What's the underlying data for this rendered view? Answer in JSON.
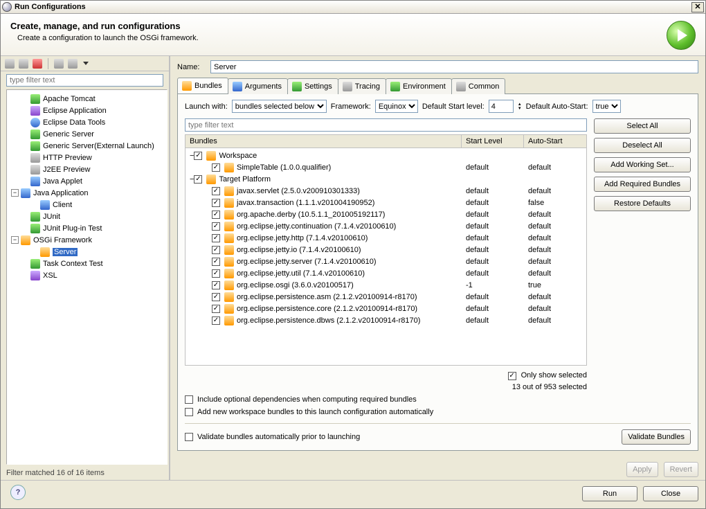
{
  "window": {
    "title": "Run Configurations"
  },
  "header": {
    "title": "Create, manage, and run configurations",
    "subtitle": "Create a configuration to launch the OSGi framework."
  },
  "leftpane": {
    "filter_placeholder": "type filter text",
    "items": [
      {
        "label": "Apache Tomcat",
        "icon": "ic-green",
        "indent": 1,
        "exp": ""
      },
      {
        "label": "Eclipse Application",
        "icon": "ic-purple",
        "indent": 1,
        "exp": ""
      },
      {
        "label": "Eclipse Data Tools",
        "icon": "ic-cyls",
        "indent": 1,
        "exp": ""
      },
      {
        "label": "Generic Server",
        "icon": "ic-green",
        "indent": 1,
        "exp": ""
      },
      {
        "label": "Generic Server(External Launch)",
        "icon": "ic-green",
        "indent": 1,
        "exp": ""
      },
      {
        "label": "HTTP Preview",
        "icon": "ic-grey",
        "indent": 1,
        "exp": ""
      },
      {
        "label": "J2EE Preview",
        "icon": "ic-grey",
        "indent": 1,
        "exp": ""
      },
      {
        "label": "Java Applet",
        "icon": "ic-blue",
        "indent": 1,
        "exp": ""
      },
      {
        "label": "Java Application",
        "icon": "ic-blue",
        "indent": 0,
        "exp": "-"
      },
      {
        "label": "Client",
        "icon": "ic-blue",
        "indent": 2,
        "exp": ""
      },
      {
        "label": "JUnit",
        "icon": "ic-green",
        "indent": 1,
        "exp": ""
      },
      {
        "label": "JUnit Plug-in Test",
        "icon": "ic-green",
        "indent": 1,
        "exp": ""
      },
      {
        "label": "OSGi Framework",
        "icon": "ic-orange",
        "indent": 0,
        "exp": "-"
      },
      {
        "label": "Server",
        "icon": "ic-orange",
        "indent": 2,
        "exp": "",
        "selected": true
      },
      {
        "label": "Task Context Test",
        "icon": "ic-green",
        "indent": 1,
        "exp": ""
      },
      {
        "label": "XSL",
        "icon": "ic-purple",
        "indent": 1,
        "exp": ""
      }
    ],
    "filter_count": "Filter matched 16 of 16 items"
  },
  "right": {
    "name_label": "Name:",
    "name_value": "Server",
    "tabs": [
      "Bundles",
      "Arguments",
      "Settings",
      "Tracing",
      "Environment",
      "Common"
    ],
    "active_tab": 0,
    "launch": {
      "label": "Launch with:",
      "launch_with": "bundles selected below",
      "framework_label": "Framework:",
      "framework": "Equinox",
      "default_start_label": "Default Start level:",
      "default_start": "4",
      "default_auto_label": "Default Auto-Start:",
      "default_auto": "true"
    },
    "bfilter_placeholder": "type filter text",
    "cols": {
      "bundles": "Bundles",
      "start": "Start Level",
      "auto": "Auto-Start"
    },
    "rows": [
      {
        "indent": 0,
        "exp": "-",
        "chk": true,
        "icon": "ic-orange",
        "label": "Workspace",
        "start": "",
        "auto": ""
      },
      {
        "indent": 1,
        "exp": "",
        "chk": true,
        "icon": "ic-orange",
        "label": "SimpleTable (1.0.0.qualifier)",
        "start": "default",
        "auto": "default"
      },
      {
        "indent": 0,
        "exp": "-",
        "chk": true,
        "icon": "ic-orange",
        "label": "Target Platform",
        "start": "",
        "auto": ""
      },
      {
        "indent": 1,
        "exp": "",
        "chk": true,
        "icon": "ic-orange",
        "label": "javax.servlet (2.5.0.v200910301333)",
        "start": "default",
        "auto": "default"
      },
      {
        "indent": 1,
        "exp": "",
        "chk": true,
        "icon": "ic-orange",
        "label": "javax.transaction (1.1.1.v201004190952)",
        "start": "default",
        "auto": "false"
      },
      {
        "indent": 1,
        "exp": "",
        "chk": true,
        "icon": "ic-orange",
        "label": "org.apache.derby (10.5.1.1_201005192117)",
        "start": "default",
        "auto": "default"
      },
      {
        "indent": 1,
        "exp": "",
        "chk": true,
        "icon": "ic-orange",
        "label": "org.eclipse.jetty.continuation (7.1.4.v20100610)",
        "start": "default",
        "auto": "default"
      },
      {
        "indent": 1,
        "exp": "",
        "chk": true,
        "icon": "ic-orange",
        "label": "org.eclipse.jetty.http (7.1.4.v20100610)",
        "start": "default",
        "auto": "default"
      },
      {
        "indent": 1,
        "exp": "",
        "chk": true,
        "icon": "ic-orange",
        "label": "org.eclipse.jetty.io (7.1.4.v20100610)",
        "start": "default",
        "auto": "default"
      },
      {
        "indent": 1,
        "exp": "",
        "chk": true,
        "icon": "ic-orange",
        "label": "org.eclipse.jetty.server (7.1.4.v20100610)",
        "start": "default",
        "auto": "default"
      },
      {
        "indent": 1,
        "exp": "",
        "chk": true,
        "icon": "ic-orange",
        "label": "org.eclipse.jetty.util (7.1.4.v20100610)",
        "start": "default",
        "auto": "default"
      },
      {
        "indent": 1,
        "exp": "",
        "chk": true,
        "icon": "ic-orange",
        "label": "org.eclipse.osgi (3.6.0.v20100517)",
        "start": "-1",
        "auto": "true"
      },
      {
        "indent": 1,
        "exp": "",
        "chk": true,
        "icon": "ic-orange",
        "label": "org.eclipse.persistence.asm (2.1.2.v20100914-r8170)",
        "start": "default",
        "auto": "default"
      },
      {
        "indent": 1,
        "exp": "",
        "chk": true,
        "icon": "ic-orange",
        "label": "org.eclipse.persistence.core (2.1.2.v20100914-r8170)",
        "start": "default",
        "auto": "default"
      },
      {
        "indent": 1,
        "exp": "",
        "chk": true,
        "icon": "ic-orange",
        "label": "org.eclipse.persistence.dbws (2.1.2.v20100914-r8170)",
        "start": "default",
        "auto": "default"
      }
    ],
    "buttons": {
      "select_all": "Select All",
      "deselect_all": "Deselect All",
      "add_working": "Add Working Set...",
      "add_required": "Add Required Bundles",
      "restore": "Restore Defaults",
      "validate": "Validate Bundles",
      "apply": "Apply",
      "revert": "Revert"
    },
    "only_show": "Only show selected",
    "count": "13 out of 953 selected",
    "chk_include": "Include optional dependencies when computing required bundles",
    "chk_addnew": "Add new workspace bundles to this launch configuration automatically",
    "chk_validate": "Validate bundles automatically prior to launching"
  },
  "footer": {
    "run": "Run",
    "close": "Close"
  }
}
